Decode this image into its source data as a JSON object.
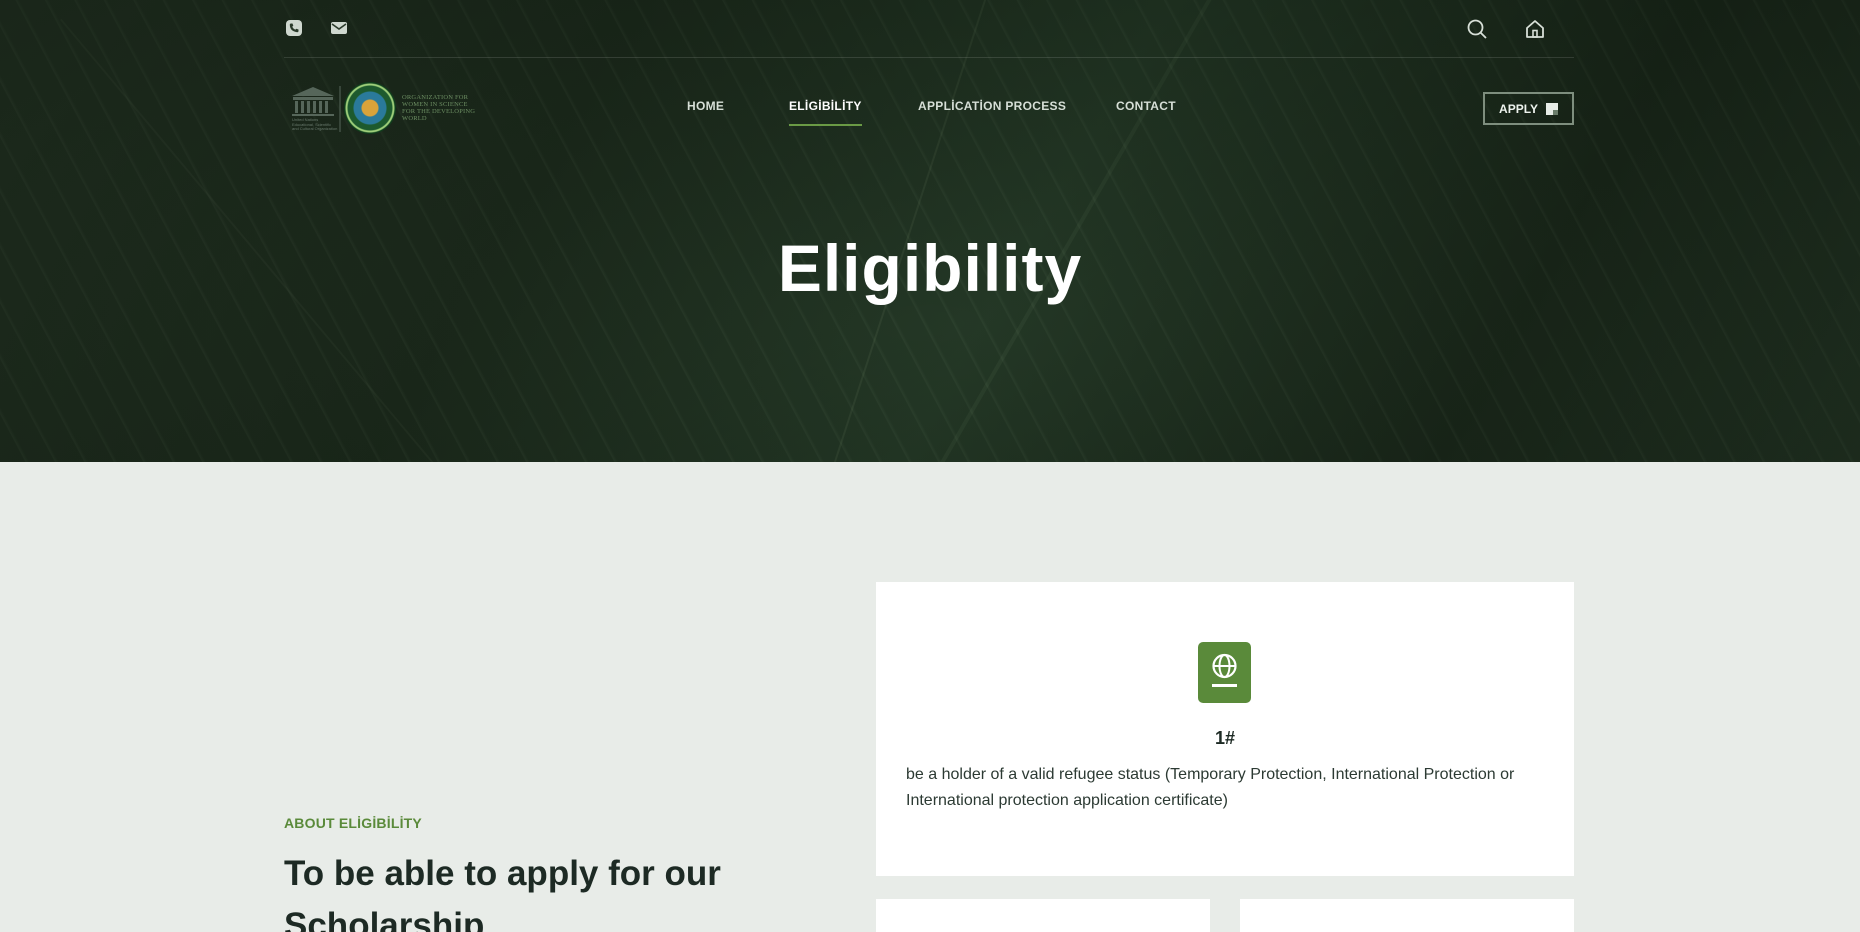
{
  "topbar": {
    "icons": [
      "phone-icon",
      "mail-icon",
      "search-icon",
      "home-icon"
    ]
  },
  "logo": {
    "org_text": "ORGANIZATION FOR WOMEN IN SCIENCE FOR THE DEVELOPING WORLD",
    "unesco_text": "United Nations Educational, Scientific and Cultural Organization"
  },
  "nav": {
    "items": [
      {
        "label": "HOME"
      },
      {
        "label": "ELİGİBİLİTY"
      },
      {
        "label": "APPLİCATİON PROCESS"
      },
      {
        "label": "CONTACT"
      }
    ],
    "active_index": 1,
    "apply_label": "APPLY"
  },
  "hero": {
    "title": "Eligibility"
  },
  "about": {
    "label": "ABOUT ELİGİBİLİTY",
    "heading": "To be able to apply for our Scholarship"
  },
  "cards": [
    {
      "number": "1#",
      "text": "be a holder of a valid refugee status (Temporary Protection, International Protection or International protection application certificate)",
      "icon": "passport-globe-icon"
    }
  ],
  "colors": {
    "accent": "#5a8a3a",
    "hero_bg": "#1f2e1f",
    "page_bg": "#e8ece8"
  }
}
